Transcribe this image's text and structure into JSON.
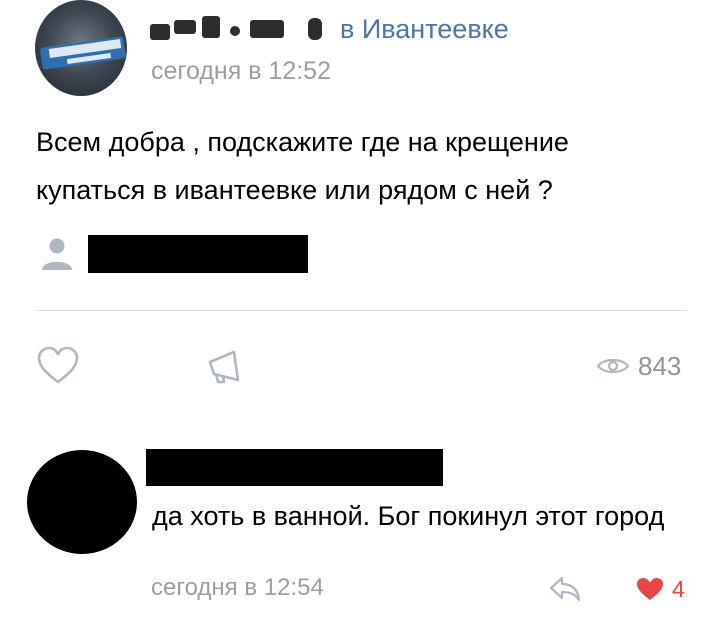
{
  "post": {
    "author": {
      "avatar_icon": "group-avatar-icon",
      "group_name": "в Ивантеевке"
    },
    "time": "сегодня в 12:52",
    "text": "Всем добра , подскажите где на крещение купаться в ивантеевке или рядом с ней ?",
    "signer_icon": "user-icon",
    "actions": {
      "like_icon": "heart-outline-icon",
      "share_icon": "megaphone-icon",
      "views_icon": "eye-icon",
      "views_count": "843"
    }
  },
  "comment": {
    "text": "да хоть в ванной. Бог покинул этот город",
    "time": "сегодня в 12:54",
    "reply_icon": "reply-arrow-icon",
    "likes_icon": "heart-filled-icon",
    "likes_count": "4"
  },
  "colors": {
    "link": "#4a76a8",
    "secondary_text": "#9a9ea3",
    "icon_gray": "#aeb7c2",
    "like_red": "#e64646"
  }
}
